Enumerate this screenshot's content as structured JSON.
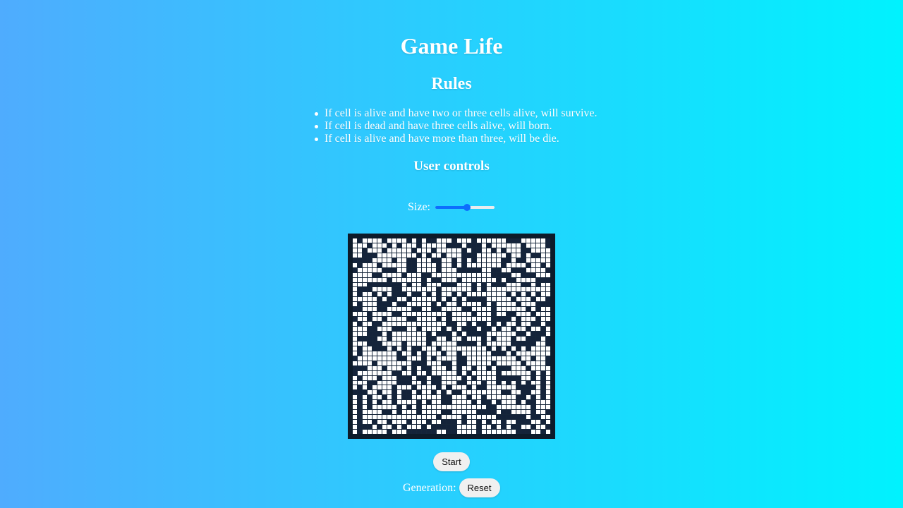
{
  "title": "Game Life",
  "rules": {
    "heading": "Rules",
    "items": [
      "If cell is alive and have two or three cells alive, will survive.",
      "If cell is dead and have three cells alive, will born.",
      "If cell is alive and have more than three, will be die."
    ]
  },
  "controls": {
    "heading": "User controls",
    "size_label": "Size:",
    "size_value_fraction": 0.54,
    "start_label": "Start",
    "generation_label": "Generation:",
    "generation_value": "",
    "reset_label": "Reset"
  },
  "board": {
    "columns": 40,
    "rows": 40,
    "alive_color": "#14233a",
    "dead_color": "#ffffff",
    "border_color": "#0d1b2a"
  },
  "colors": {
    "background_start": "#4facfe",
    "background_end": "#00f2fe",
    "accent": "#0d6efd"
  }
}
